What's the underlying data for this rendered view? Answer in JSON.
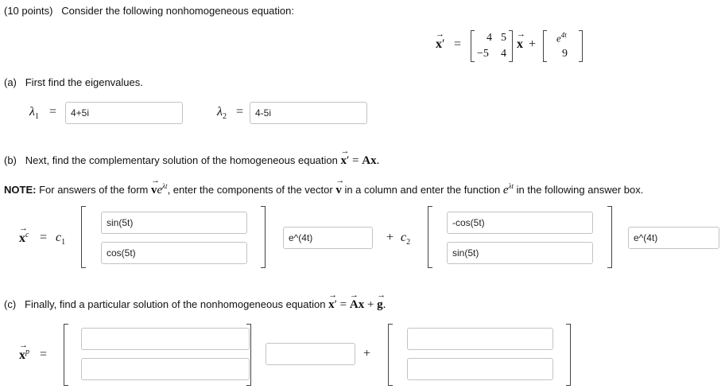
{
  "header": {
    "points": "(10 points)",
    "prompt": "Consider the following nonhomogeneous equation:"
  },
  "equation": {
    "lhs": "x",
    "prime": "′",
    "eq": "=",
    "matrix": [
      "4",
      "5",
      "−5",
      "4"
    ],
    "x_var": "x",
    "plus": "+",
    "forcing": [
      "e",
      "4t",
      "9"
    ]
  },
  "part_a": {
    "label": "(a)",
    "text": "First find the eigenvalues.",
    "lambda1_symbol": "λ",
    "lambda1_sub": "1",
    "lambda1_value": "4+5i",
    "lambda2_symbol": "λ",
    "lambda2_sub": "2",
    "lambda2_value": "4-5i",
    "eq": "="
  },
  "part_b": {
    "label": "(b)",
    "text": "Next, find the complementary solution of the homogeneous equation",
    "eq_lhs": "x",
    "eq_prime": "′",
    "eq_eq": "=",
    "eq_rhs": "Ax",
    "period": "."
  },
  "note": {
    "title": "NOTE:",
    "text1": "For answers of the form",
    "form_v": "v",
    "form_e": "e",
    "form_exp": "λt",
    "text2": ", enter the components of the vector",
    "vec_v": "v",
    "text3": "in a column and enter the function",
    "func_e": "e",
    "func_exp": "λt",
    "text4": "in the following answer box."
  },
  "complementary": {
    "xc": "x",
    "xc_sup": "c",
    "eq": "=",
    "c1": "c",
    "c1_sub": "1",
    "plus": "+",
    "c2": "c",
    "c2_sub": "2",
    "v1_top": "sin(5t)",
    "v1_bottom": "cos(5t)",
    "f1": "e^(4t)",
    "v2_top": "-cos(5t)",
    "v2_bottom": "sin(5t)",
    "f2": "e^(4t)"
  },
  "part_c": {
    "label": "(c)",
    "text": "Finally, find a particular solution of the nonhomogeneous equation",
    "eq_lhs": "x",
    "eq_prime": "′",
    "eq_eq": "=",
    "eq_rhs": "Ax",
    "eq_plus": "+",
    "eq_g": "g",
    "period": "."
  },
  "particular": {
    "xp": "x",
    "xp_sup": "p",
    "eq": "=",
    "plus": "+",
    "v1_top": "",
    "v1_bottom": "",
    "f1": "",
    "v2_top": "",
    "v2_bottom": ""
  }
}
